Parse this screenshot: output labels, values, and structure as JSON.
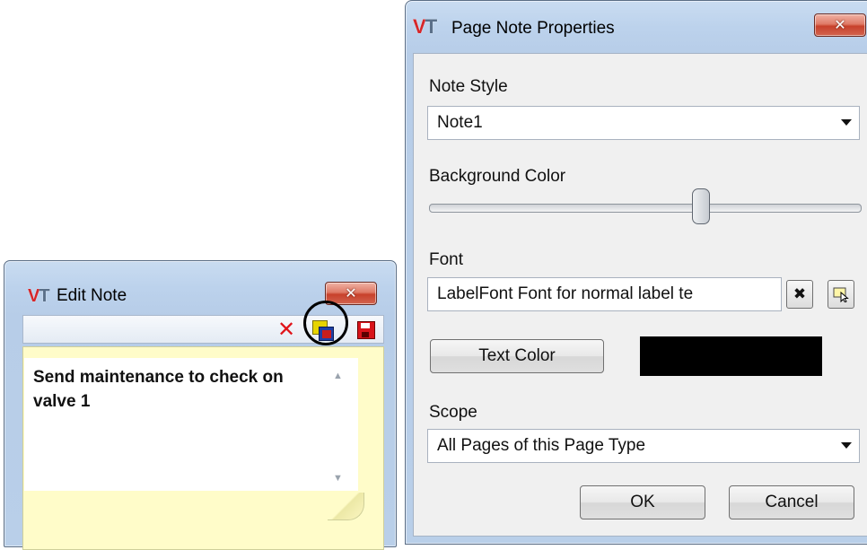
{
  "edit_note": {
    "title": "Edit Note",
    "close_icon": "close-icon",
    "note_text": "Send maintenance to check on valve 1",
    "toolbar": {
      "delete_icon": "delete-icon",
      "color_icon": "note-color-icon",
      "save_icon": "save-icon"
    }
  },
  "props": {
    "title": "Page Note Properties",
    "note_style": {
      "label": "Note Style",
      "value": "Note1"
    },
    "background_color": {
      "label": "Background Color",
      "level": 0.63
    },
    "font": {
      "label": "Font",
      "value": "LabelFont    Font for normal label te"
    },
    "text_color": {
      "button": "Text Color",
      "swatch": "#000000"
    },
    "scope": {
      "label": "Scope",
      "value": "All Pages of this Page Type"
    },
    "ok": "OK",
    "cancel": "Cancel"
  },
  "logo": {
    "v": "V",
    "t": "T"
  },
  "colors": {
    "accent_close": "#c8412b",
    "note_paper": "#fffcc9"
  }
}
